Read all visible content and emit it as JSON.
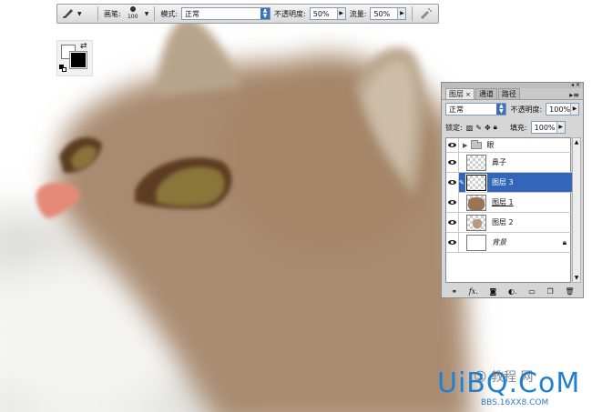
{
  "options_bar": {
    "brush_label": "画笔:",
    "brush_size": "100",
    "mode_label": "模式:",
    "mode_value": "正常",
    "opacity_label": "不透明度:",
    "opacity_value": "50%",
    "flow_label": "流量:",
    "flow_value": "50%"
  },
  "layers_panel": {
    "tabs": [
      {
        "label": "图层",
        "close": "×"
      },
      {
        "label": "通道"
      },
      {
        "label": "路径"
      }
    ],
    "blend_mode": "正常",
    "opacity_label": "不透明度:",
    "opacity_value": "100%",
    "lock_label": "锁定:",
    "fill_label": "填充:",
    "fill_value": "100%",
    "layers": [
      {
        "name": "眼",
        "type": "group",
        "visible": true
      },
      {
        "name": "鼻子",
        "type": "layer",
        "visible": true
      },
      {
        "name": "图层 3",
        "type": "layer",
        "visible": true,
        "selected": true
      },
      {
        "name": "图层 1",
        "type": "layer",
        "visible": true
      },
      {
        "name": "图层 2",
        "type": "layer",
        "visible": true
      },
      {
        "name": "背景",
        "type": "background",
        "visible": true,
        "locked": true
      }
    ]
  },
  "watermark": {
    "main": "UiBQ.CoM",
    "overlay_cn": "☺ 教程 网",
    "sub": "BBS.16XX8.COM"
  },
  "colors": {
    "cat_fur": "#a98b71",
    "ear_inner": "#c9b8a3",
    "eye_iris": "#86713a",
    "eye_dark": "#5a3a22",
    "nose": "#e38c79",
    "selected_layer": "#3366b8"
  }
}
